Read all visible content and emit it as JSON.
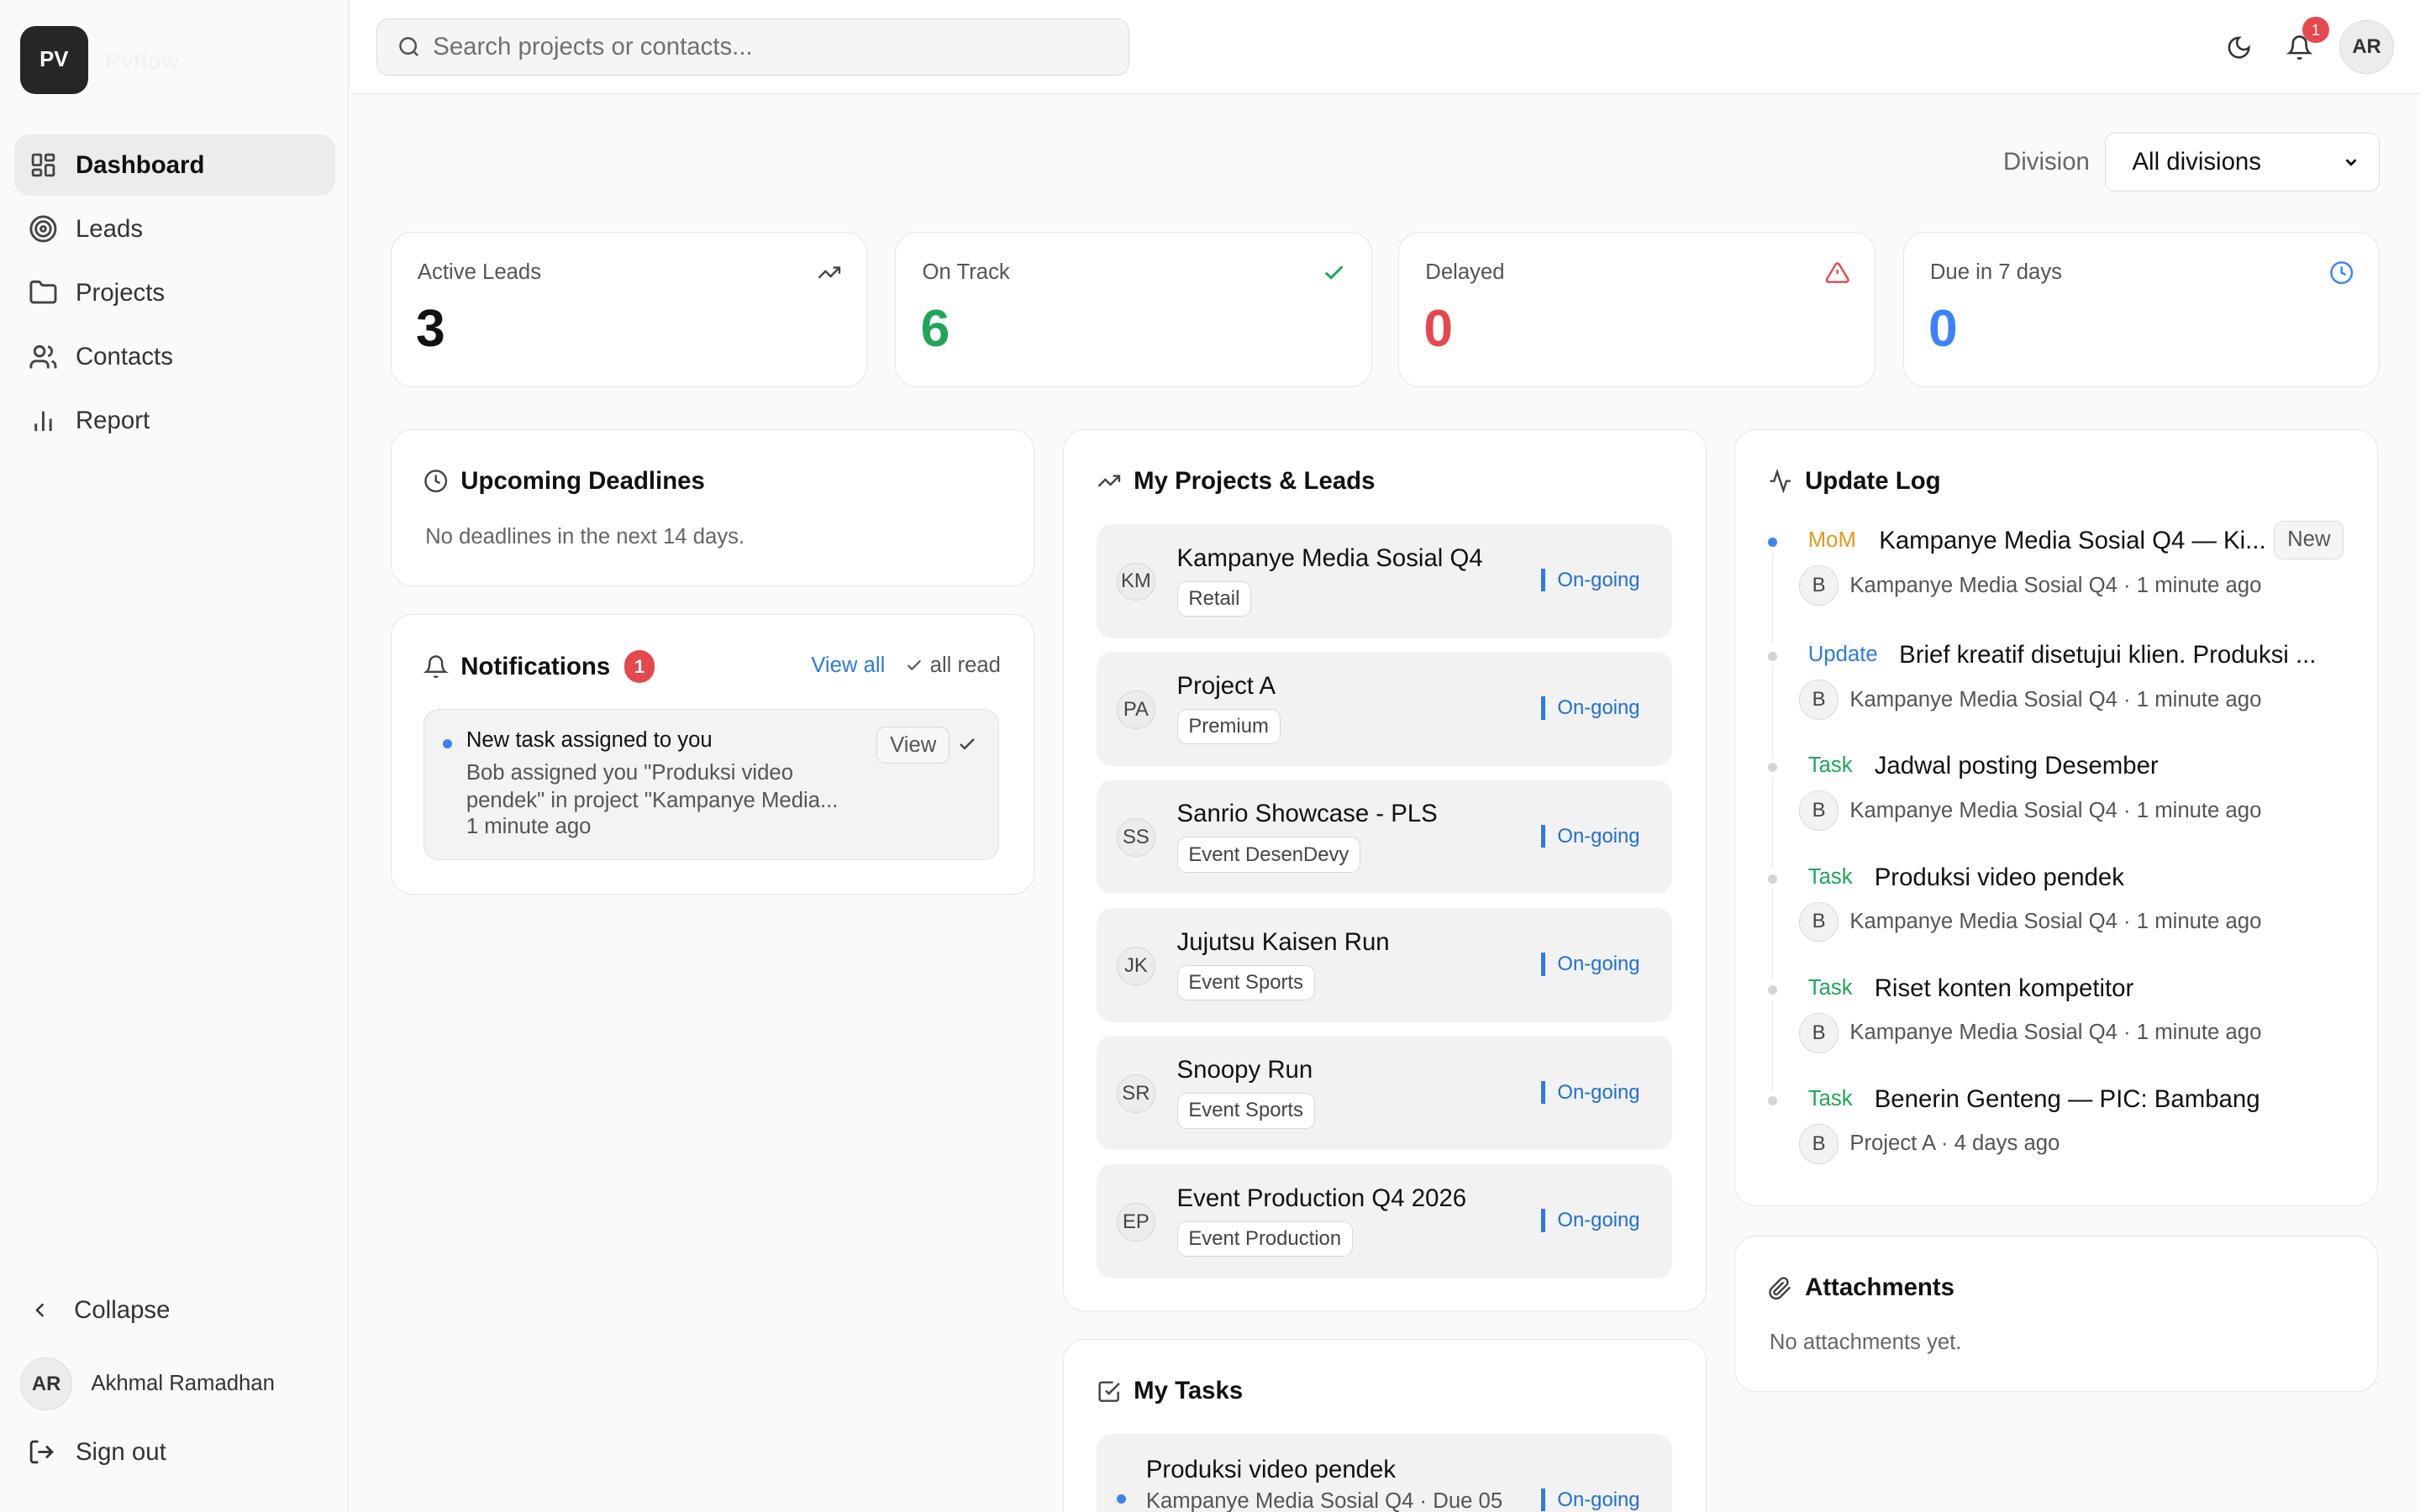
{
  "app": {
    "logo_initials": "PV",
    "logo_name": "Pvflow"
  },
  "sidebar": {
    "items": [
      {
        "label": "Dashboard",
        "icon": "dashboard-icon",
        "active": true
      },
      {
        "label": "Leads",
        "icon": "target-icon",
        "active": false
      },
      {
        "label": "Projects",
        "icon": "folder-icon",
        "active": false
      },
      {
        "label": "Contacts",
        "icon": "users-icon",
        "active": false
      },
      {
        "label": "Report",
        "icon": "bar-chart-icon",
        "active": false
      }
    ],
    "collapse_label": "Collapse",
    "user": {
      "initials": "AR",
      "name": "Akhmal Ramadhan"
    },
    "signout_label": "Sign out"
  },
  "header": {
    "search_placeholder": "Search projects or contacts...",
    "notification_count": "1",
    "avatar_initials": "AR"
  },
  "filter": {
    "label": "Division",
    "selected": "All divisions"
  },
  "stats": [
    {
      "label": "Active Leads",
      "value": "3",
      "color": "#111111",
      "icon": "trending-up-icon"
    },
    {
      "label": "On Track",
      "value": "6",
      "color": "#22a55a",
      "icon": "check-icon"
    },
    {
      "label": "Delayed",
      "value": "0",
      "color": "#e5484d",
      "icon": "alert-triangle-icon"
    },
    {
      "label": "Due in 7 days",
      "value": "0",
      "color": "#3b82f6",
      "icon": "clock-icon"
    }
  ],
  "deadlines": {
    "title": "Upcoming Deadlines",
    "empty": "No deadlines in the next 14 days."
  },
  "notifications": {
    "title": "Notifications",
    "count": "1",
    "view_all": "View all",
    "mark_read": "all read",
    "items": [
      {
        "title": "New task assigned to you",
        "body_line1": "Bob assigned you \"Produksi video",
        "body_line2": "pendek\" in project \"Kampanye Media...",
        "time": "1 minute ago",
        "view_label": "View"
      }
    ]
  },
  "projects": {
    "title": "My Projects & Leads",
    "items": [
      {
        "initials": "KM",
        "name": "Kampanye Media Sosial Q4",
        "tag": "Retail",
        "status": "On-going"
      },
      {
        "initials": "PA",
        "name": "Project A",
        "tag": "Premium",
        "status": "On-going"
      },
      {
        "initials": "SS",
        "name": "Sanrio Showcase - PLS",
        "tag": "Event DesenDevy",
        "status": "On-going"
      },
      {
        "initials": "JK",
        "name": "Jujutsu Kaisen Run",
        "tag": "Event Sports",
        "status": "On-going"
      },
      {
        "initials": "SR",
        "name": "Snoopy Run",
        "tag": "Event Sports",
        "status": "On-going"
      },
      {
        "initials": "EP",
        "name": "Event Production Q4 2026",
        "tag": "Event Production",
        "status": "On-going"
      }
    ]
  },
  "tasks": {
    "title": "My Tasks",
    "items": [
      {
        "name": "Produksi video pendek",
        "sub": "Kampanye Media Sosial Q4 · Due 05",
        "status": "On-going"
      }
    ]
  },
  "update_log": {
    "title": "Update Log",
    "new_badge": "New",
    "items": [
      {
        "type": "MoM",
        "type_color": "#e09a1a",
        "title": "Kampanye Media Sosial Q4 — Ki...",
        "avatar": "B",
        "meta": "Kampanye Media Sosial Q4 · 1 minute ago"
      },
      {
        "type": "Update",
        "type_color": "#2d7be0",
        "title": "Brief kreatif disetujui klien. Produksi ...",
        "avatar": "B",
        "meta": "Kampanye Media Sosial Q4 · 1 minute ago"
      },
      {
        "type": "Task",
        "type_color": "#22a55a",
        "title": "Jadwal posting Desember",
        "avatar": "B",
        "meta": "Kampanye Media Sosial Q4 · 1 minute ago"
      },
      {
        "type": "Task",
        "type_color": "#22a55a",
        "title": "Produksi video pendek",
        "avatar": "B",
        "meta": "Kampanye Media Sosial Q4 · 1 minute ago"
      },
      {
        "type": "Task",
        "type_color": "#22a55a",
        "title": "Riset konten kompetitor",
        "avatar": "B",
        "meta": "Kampanye Media Sosial Q4 · 1 minute ago"
      },
      {
        "type": "Task",
        "type_color": "#22a55a",
        "title": "Benerin Genteng — PIC: Bambang",
        "avatar": "B",
        "meta": "Project A · 4 days ago"
      }
    ]
  },
  "attachments": {
    "title": "Attachments",
    "empty": "No attachments yet."
  }
}
